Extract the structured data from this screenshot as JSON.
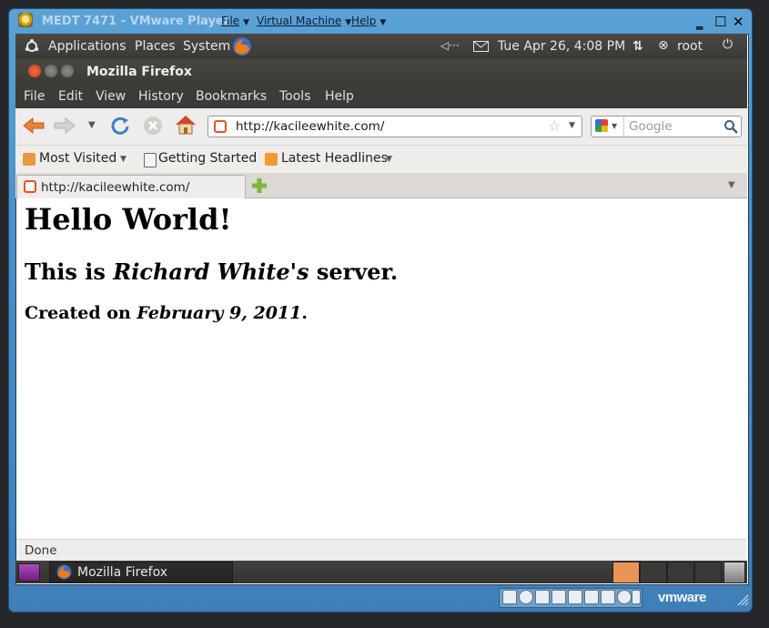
{
  "vmware": {
    "title": "MEDT 7471 - VMware Player",
    "menu": [
      "File",
      "Virtual Machine",
      "Help"
    ],
    "brand": "vmware",
    "colors": {
      "frame": "#4a8fc7"
    }
  },
  "gnome_panel": {
    "items": [
      "Applications",
      "Places",
      "System"
    ],
    "datetime": "Tue Apr 26,  4:08 PM",
    "user": "root"
  },
  "firefox": {
    "window_title": "Mozilla Firefox",
    "menu": [
      "File",
      "Edit",
      "View",
      "History",
      "Bookmarks",
      "Tools",
      "Help"
    ],
    "url": "http://kacileewhite.com/",
    "search_placeholder": "Google",
    "bookmarks": [
      "Most Visited",
      "Getting Started",
      "Latest Headlines"
    ],
    "tab_title": "http://kacileewhite.com/",
    "status": "Done"
  },
  "page": {
    "heading": "Hello World!",
    "line2_pre": "This is ",
    "line2_em": "Richard White's",
    "line2_post": " server.",
    "line3_pre": "Created on ",
    "line3_em": "February 9, 2011",
    "line3_post": "."
  },
  "taskbar": {
    "window_label": "Mozilla Firefox"
  }
}
